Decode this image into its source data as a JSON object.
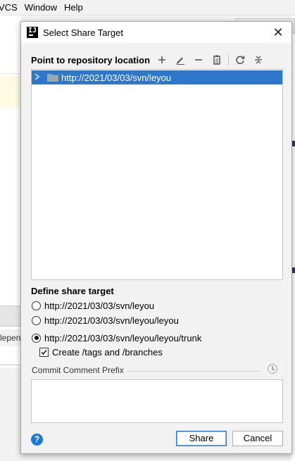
{
  "background": {
    "menu": [
      "VCS",
      "Window",
      "Help"
    ],
    "left_pane_fragment": "lepen"
  },
  "dialog": {
    "title": "Select Share Target",
    "repository_section": {
      "label": "Point to repository location",
      "toolbar_icons": [
        "add-icon",
        "edit-icon",
        "remove-icon",
        "clipboard-icon",
        "refresh-icon",
        "collapse-icon"
      ],
      "tree": [
        {
          "label": "http://2021/03/03/svn/leyou",
          "selected": true,
          "expanded": false
        }
      ]
    },
    "target_section": {
      "label": "Define share target",
      "options": [
        {
          "label": "http://2021/03/03/svn/leyou",
          "selected": false
        },
        {
          "label": "http://2021/03/03/svn/leyou/leyou",
          "selected": false
        },
        {
          "label": "http://2021/03/03/svn/leyou/leyou/trunk",
          "selected": true
        }
      ],
      "create_tags_branches": {
        "label": "Create /tags and /branches",
        "checked": true
      }
    },
    "prefix_section": {
      "label": "Commit Comment Prefix",
      "value": ""
    },
    "buttons": {
      "help": "?",
      "share": "Share",
      "cancel": "Cancel"
    }
  }
}
